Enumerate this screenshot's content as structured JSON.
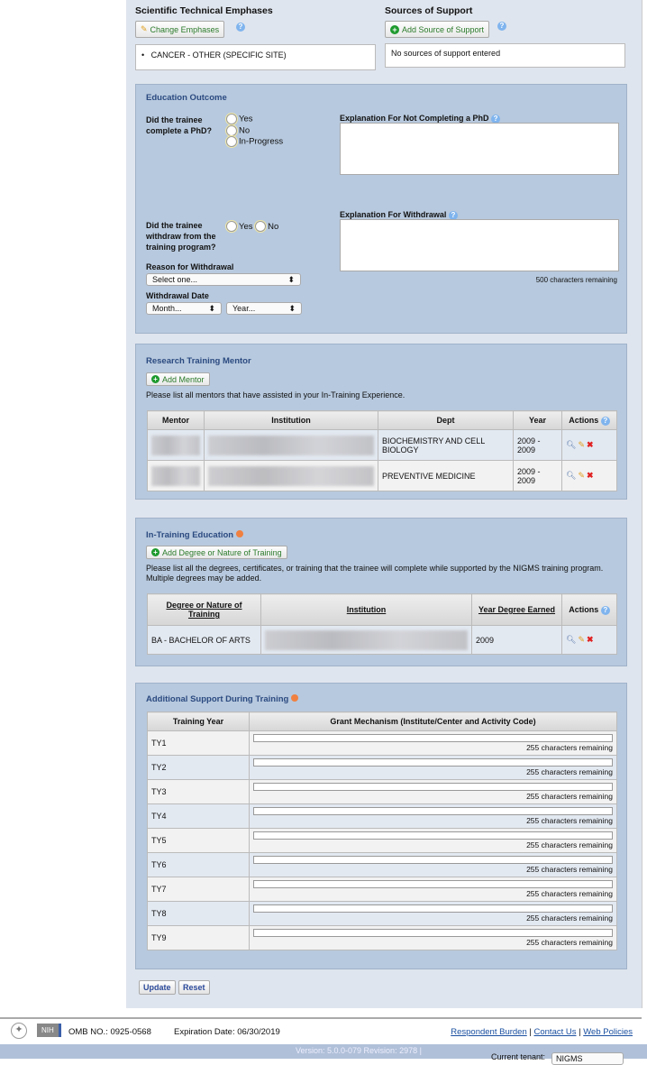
{
  "emphases": {
    "title": "Scientific Technical Emphases",
    "button": "Change Emphases",
    "items": [
      "CANCER - OTHER (SPECIFIC SITE)"
    ]
  },
  "support": {
    "title": "Sources of Support",
    "button": "Add Source of Support",
    "empty": "No sources of support entered"
  },
  "education": {
    "title": "Education Outcome",
    "phd_question": "Did the trainee complete a PhD?",
    "phd_options": [
      "Yes",
      "No",
      "In-Progress"
    ],
    "not_completing_label": "Explanation For Not Completing a PhD",
    "withdraw_question": "Did the trainee withdraw from the training program?",
    "withdraw_options": [
      "Yes",
      "No"
    ],
    "withdrawal_label": "Explanation For Withdrawal",
    "chars_remaining": "500 characters remaining",
    "reason_label": "Reason for Withdrawal",
    "reason_value": "Select one...",
    "date_label": "Withdrawal Date",
    "month_value": "Month...",
    "year_value": "Year..."
  },
  "mentor": {
    "title": "Research Training Mentor",
    "button": "Add Mentor",
    "instructions": "Please list all mentors that have assisted in your In-Training Experience.",
    "headers": [
      "Mentor",
      "Institution",
      "Dept",
      "Year",
      "Actions"
    ],
    "rows": [
      {
        "dept": "BIOCHEMISTRY AND CELL BIOLOGY",
        "year": "2009 - 2009"
      },
      {
        "dept": "PREVENTIVE MEDICINE",
        "year": "2009 - 2009"
      }
    ]
  },
  "training": {
    "title": "In-Training Education",
    "button": "Add Degree or Nature of Training",
    "instructions": "Please list all the degrees, certificates, or training that the trainee will complete while supported by the NIGMS training program. Multiple degrees may be added.",
    "headers": [
      "Degree or Nature of Training",
      "Institution",
      "Year Degree Earned",
      "Actions"
    ],
    "rows": [
      {
        "degree": "BA - BACHELOR OF ARTS",
        "year": "2009"
      }
    ]
  },
  "additional": {
    "title": "Additional Support During Training",
    "headers": [
      "Training Year",
      "Grant Mechanism (Institute/Center and Activity Code)"
    ],
    "remaining": "255 characters remaining",
    "years": [
      "TY1",
      "TY2",
      "TY3",
      "TY4",
      "TY5",
      "TY6",
      "TY7",
      "TY8",
      "TY9"
    ]
  },
  "actions": {
    "update": "Update",
    "reset": "Reset"
  },
  "footer": {
    "logo": "NIH",
    "omb": "OMB NO.: 0925-0568",
    "expiration": "Expiration Date: 06/30/2019",
    "links": [
      "Respondent Burden",
      "Contact Us",
      "Web Policies"
    ],
    "version": "Version: 5.0.0-079 Revision: 2978 |",
    "tenant_label": "Current tenant:",
    "tenant_value": "NIGMS"
  }
}
